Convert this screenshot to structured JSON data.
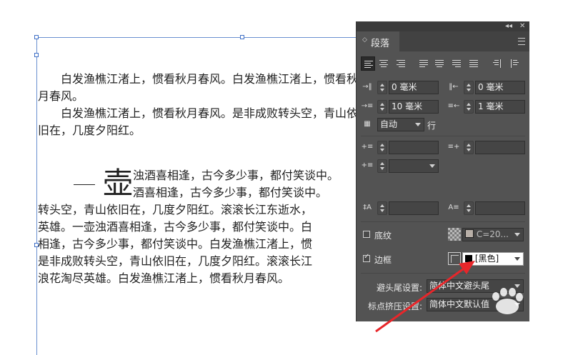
{
  "document": {
    "paragraphs": [
      "　　白发渔樵江渚上，惯看秋月春风。白发渔樵江渚上，惯看秋",
      "月春风。",
      "　　白发渔樵江渚上，惯看秋月春风。是非成败转头空，青山依",
      "旧在，几度夕阳红。"
    ],
    "dropcap": "壶",
    "dropcap_lines": [
      "浊酒喜相逢，古今多少事，都付笑谈中。",
      "酒喜相逢，古今多少事，都付笑谈中。"
    ],
    "lines": [
      "转头空，青山依旧在，几度夕阳红。滚滚长江东逝水，",
      "英雄。一壶浊酒喜相逢，古今多少事，都付笑谈中。白",
      "相逢，古今多少事，都付笑谈中。白发渔樵江渚上，惯",
      "是非成败转头空，青山依旧在，几度夕阳红。滚滚长江",
      "浪花淘尽英雄。白发渔樵江渚上，惯看秋月春风。"
    ]
  },
  "panel": {
    "topbar": {
      "collapse": "◂◂",
      "close": "✕"
    },
    "tab_label": "段落",
    "left_indent": "0 毫米",
    "right_indent": "0 毫米",
    "first_line_indent": "10 毫米",
    "last_line_indent": "1 毫米",
    "grid_select": "自动",
    "grid_suffix": "行",
    "shading_label": "底纹",
    "shading_color": "C=20...",
    "border_label": "边框",
    "border_color": "[黑色]",
    "border_checked": true,
    "kinsoku_label": "避头尾设置:",
    "kinsoku_value": "简体中文避头尾",
    "mojikumi_label": "标点挤压设置:",
    "mojikumi_value": "简体中文默认值"
  },
  "colors": {
    "panel_bg": "#535353",
    "arrow": "#e8262a",
    "frame": "#6a8fd0"
  }
}
